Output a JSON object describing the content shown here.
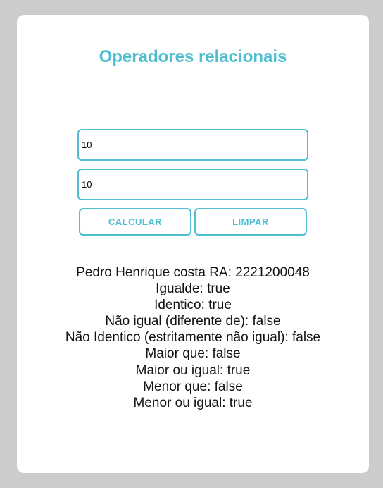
{
  "page": {
    "title": "Operadores relacionais"
  },
  "form": {
    "value1": "10",
    "value2": "10",
    "calculate_label": "CALCULAR",
    "clear_label": "LIMPAR"
  },
  "results": {
    "author": "Pedro Henrique costa RA: 2221200048",
    "equal": "Igualde: true",
    "identical": "Identico: true",
    "not_equal": "Não igual (diferente de): false",
    "not_identical": "Não Identico (estritamente não igual): false",
    "greater": "Maior que: false",
    "greater_equal": "Maior ou igual: true",
    "less": "Menor que: false",
    "less_equal": "Menor ou igual: true"
  }
}
